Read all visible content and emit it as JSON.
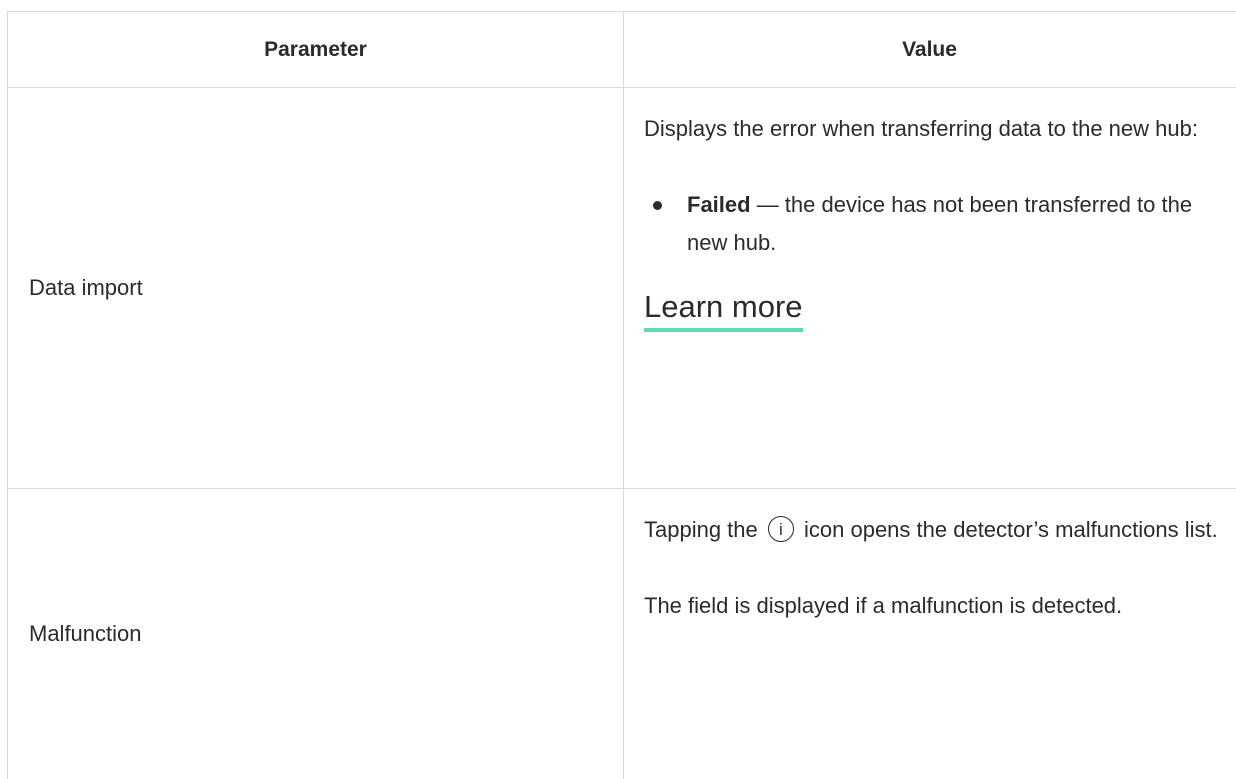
{
  "table": {
    "headers": {
      "parameter": "Parameter",
      "value": "Value"
    },
    "rows": [
      {
        "parameter": "Data import",
        "intro": "Displays the error when transferring data to the new hub:",
        "bullets": [
          {
            "term": "Failed",
            "description": " — the device has not been transferred to the new hub."
          }
        ],
        "link_label": "Learn more"
      },
      {
        "parameter": "Malfunction",
        "text_before_icon": "Tapping the",
        "icon_glyph": "i",
        "text_after_icon": " icon opens the detector’s malfunctions list.",
        "note": "The field is displayed if a malfunction is detected."
      }
    ]
  },
  "colors": {
    "text": "#2b2b2b",
    "border": "#d9d9d9",
    "link_underline": "#5fdcae"
  },
  "icons": {
    "info": "info-circle-icon"
  }
}
